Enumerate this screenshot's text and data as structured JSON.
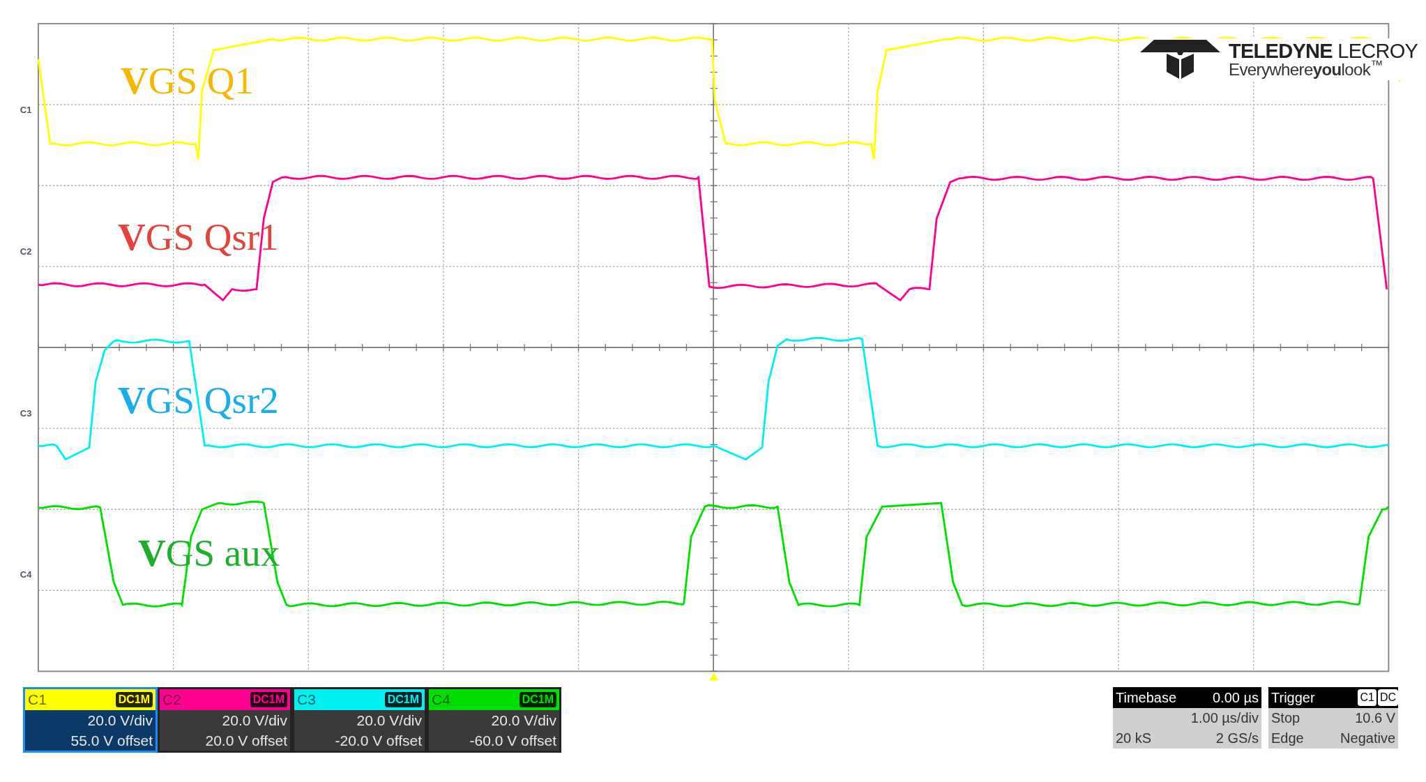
{
  "logo": {
    "name": "**TELEDYNE** LECROY",
    "tagline": "Everywhere**you**look$^{™}$"
  },
  "annotations": [
    {
      "text": "**V**GS Q1",
      "color": "#f5b800"
    },
    {
      "text": "**V**GS Qsr1",
      "color": "#e0443c"
    },
    {
      "text": "**V**GS Qsr2",
      "color": "#1aaee8"
    },
    {
      "text": "**V**GS aux",
      "color": "#1fae2c"
    }
  ],
  "channels": [
    {
      "label": "C1",
      "marker": "C1",
      "coupling": "DC1M",
      "scale": "20.0 V/div",
      "offset": "55.0 V offset",
      "color": "#ffff00",
      "selected": true
    },
    {
      "label": "C2",
      "marker": "C2",
      "coupling": "DC1M",
      "scale": "20.0 V/div",
      "offset": "20.0 V offset",
      "color": "#ff0090",
      "selected": false
    },
    {
      "label": "C3",
      "marker": "C3",
      "coupling": "DC1M",
      "scale": "20.0 V/div",
      "offset": "-20.0 V offset",
      "color": "#00f0f0",
      "selected": false
    },
    {
      "label": "C4",
      "marker": "C4",
      "coupling": "DC1M",
      "scale": "20.0 V/div",
      "offset": "-60.0 V offset",
      "color": "#00e000",
      "selected": false
    }
  ],
  "timebase": {
    "title": "Timebase",
    "delay": "0.00 µs",
    "scale": "1.00 µs/div",
    "samples": "20 kS",
    "rate": "2 GS/s"
  },
  "trigger": {
    "title": "Trigger",
    "source": "C1",
    "coupling": "DC",
    "mode": "Stop",
    "trigger_level": "10.6 V",
    "type": "Edge",
    "slope": "Negative"
  }
}
